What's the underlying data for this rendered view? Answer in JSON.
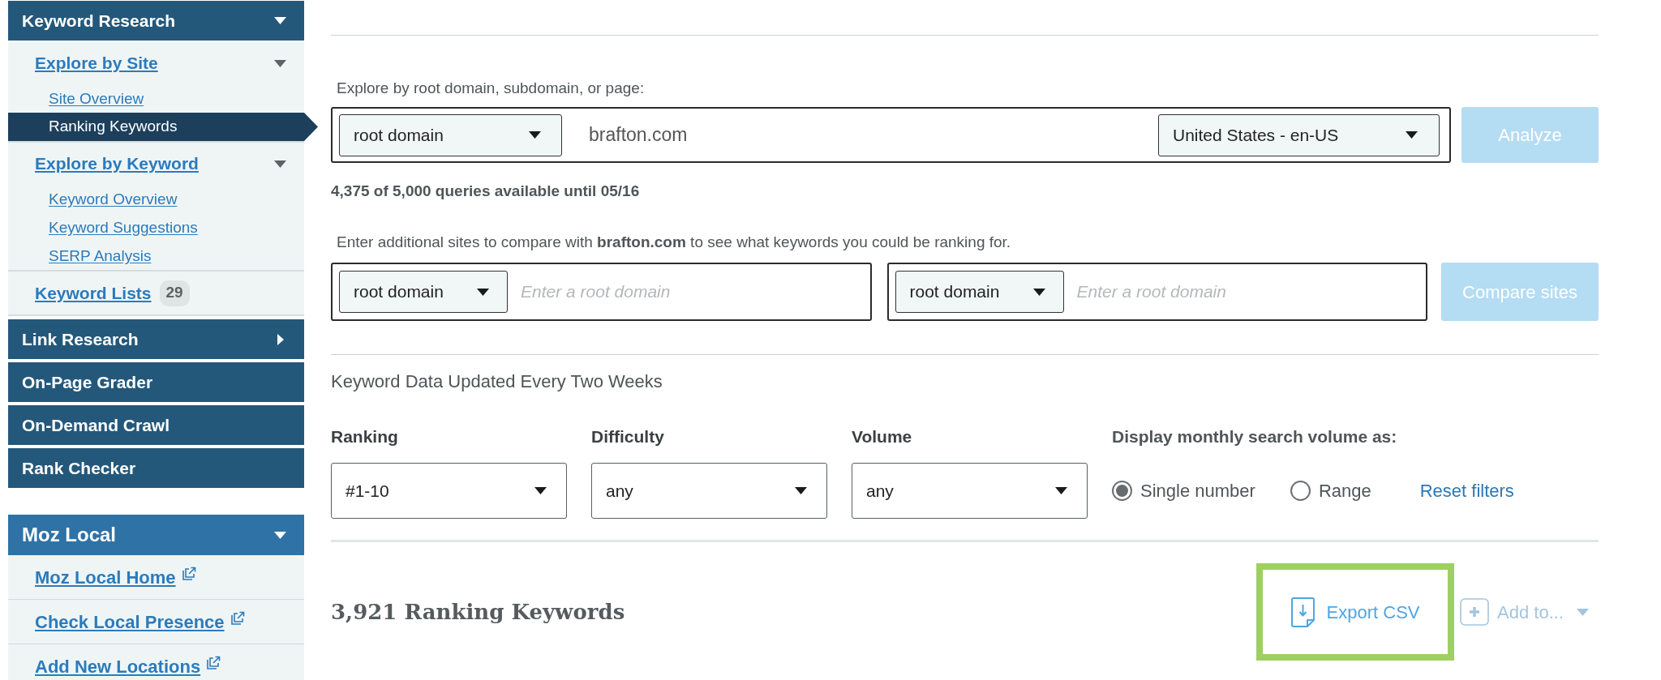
{
  "sidebar": {
    "sections": [
      {
        "title": "Keyword Research",
        "kind": "menu",
        "expanded": true,
        "items": [
          {
            "label": "Explore by Site",
            "kind": "group",
            "expanded": true,
            "children": [
              {
                "label": "Site Overview",
                "selected": false
              },
              {
                "label": "Ranking Keywords",
                "selected": true
              }
            ]
          },
          {
            "label": "Explore by Keyword",
            "kind": "group",
            "expanded": true,
            "children": [
              {
                "label": "Keyword Overview",
                "selected": false
              },
              {
                "label": "Keyword Suggestions",
                "selected": false
              },
              {
                "label": "SERP Analysis",
                "selected": false
              }
            ]
          },
          {
            "label": "Keyword Lists",
            "kind": "link",
            "badge": "29"
          }
        ]
      },
      {
        "title": "Link Research",
        "kind": "menu",
        "expanded": false
      },
      {
        "title": "On-Page Grader",
        "kind": "link"
      },
      {
        "title": "On-Demand Crawl",
        "kind": "link"
      },
      {
        "title": "Rank Checker",
        "kind": "link"
      }
    ],
    "moz_local": {
      "title": "Moz Local",
      "expanded": true,
      "links": [
        {
          "label": "Moz Local Home",
          "external": true
        },
        {
          "label": "Check Local Presence",
          "external": true
        },
        {
          "label": "Add New Locations",
          "external": true
        }
      ]
    }
  },
  "explore": {
    "label": "Explore by root domain, subdomain, or page:",
    "scope": "root domain",
    "value": "brafton.com",
    "locale": "United States - en-US",
    "analyze_button": {
      "label": "Analyze",
      "disabled": true
    }
  },
  "quota": "4,375 of 5,000 queries available until 05/16",
  "compare": {
    "label": "Enter additional sites to compare with **brafton.com** to see what keywords you could be ranking for.",
    "sites": [
      {
        "scope": "root domain",
        "placeholder": "Enter a root domain"
      },
      {
        "scope": "root domain",
        "placeholder": "Enter a root domain"
      }
    ],
    "compare_button": {
      "label": "Compare sites",
      "disabled": true
    }
  },
  "update_note": "Keyword Data Updated Every Two Weeks",
  "filters": [
    {
      "label": "Ranking",
      "value": "#1-10"
    },
    {
      "label": "Difficulty",
      "value": "any"
    },
    {
      "label": "Volume",
      "value": "any"
    }
  ],
  "volume_display": {
    "label": "Display monthly search volume as:",
    "options": [
      {
        "label": "Single number",
        "selected": true
      },
      {
        "label": "Range",
        "selected": false
      }
    ]
  },
  "reset_filters": "Reset filters",
  "results": {
    "title": "3,921 Ranking Keywords",
    "actions": [
      {
        "kind": "export",
        "label": "Export CSV",
        "highlighted": true,
        "disabled": false
      },
      {
        "kind": "add",
        "label": "Add to...",
        "highlighted": false,
        "disabled": true
      }
    ]
  }
}
